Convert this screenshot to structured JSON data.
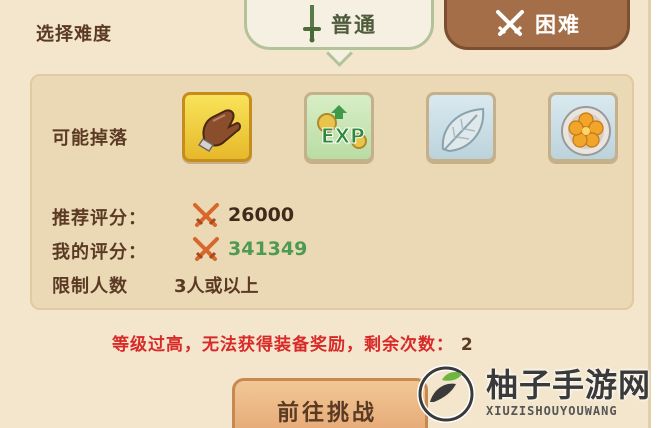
{
  "header": {
    "title": "选择难度"
  },
  "tabs": [
    {
      "label": "普通",
      "icon": "sword-icon",
      "selected": true
    },
    {
      "label": "困难",
      "icon": "crossed-swords-icon",
      "selected": false
    }
  ],
  "drops": {
    "label": "可能掉落",
    "items": [
      {
        "icon": "glove-icon",
        "quality": "gold"
      },
      {
        "icon": "exp-icon",
        "badge": "EXP",
        "quality": "green"
      },
      {
        "icon": "leaf-icon",
        "quality": "blue"
      },
      {
        "icon": "flower-plate-icon",
        "quality": "blue"
      }
    ]
  },
  "stats": {
    "recommended": {
      "label": "推荐评分：",
      "value": "26000"
    },
    "mine": {
      "label": "我的评分：",
      "value": "341349"
    },
    "limit": {
      "label": "限制人数",
      "value": "3人或以上"
    }
  },
  "warning": {
    "text": "等级过高，无法获得装备奖励，剩余次数：",
    "count": "2"
  },
  "action": {
    "label": "前往挑战"
  },
  "watermark": {
    "cn": "柚子手游网",
    "en": "XIUZISHOUYOUWANG"
  },
  "colors": {
    "panel": "#f3e6cd",
    "warning": "#d92a2a",
    "my_score": "#4d9a52"
  }
}
